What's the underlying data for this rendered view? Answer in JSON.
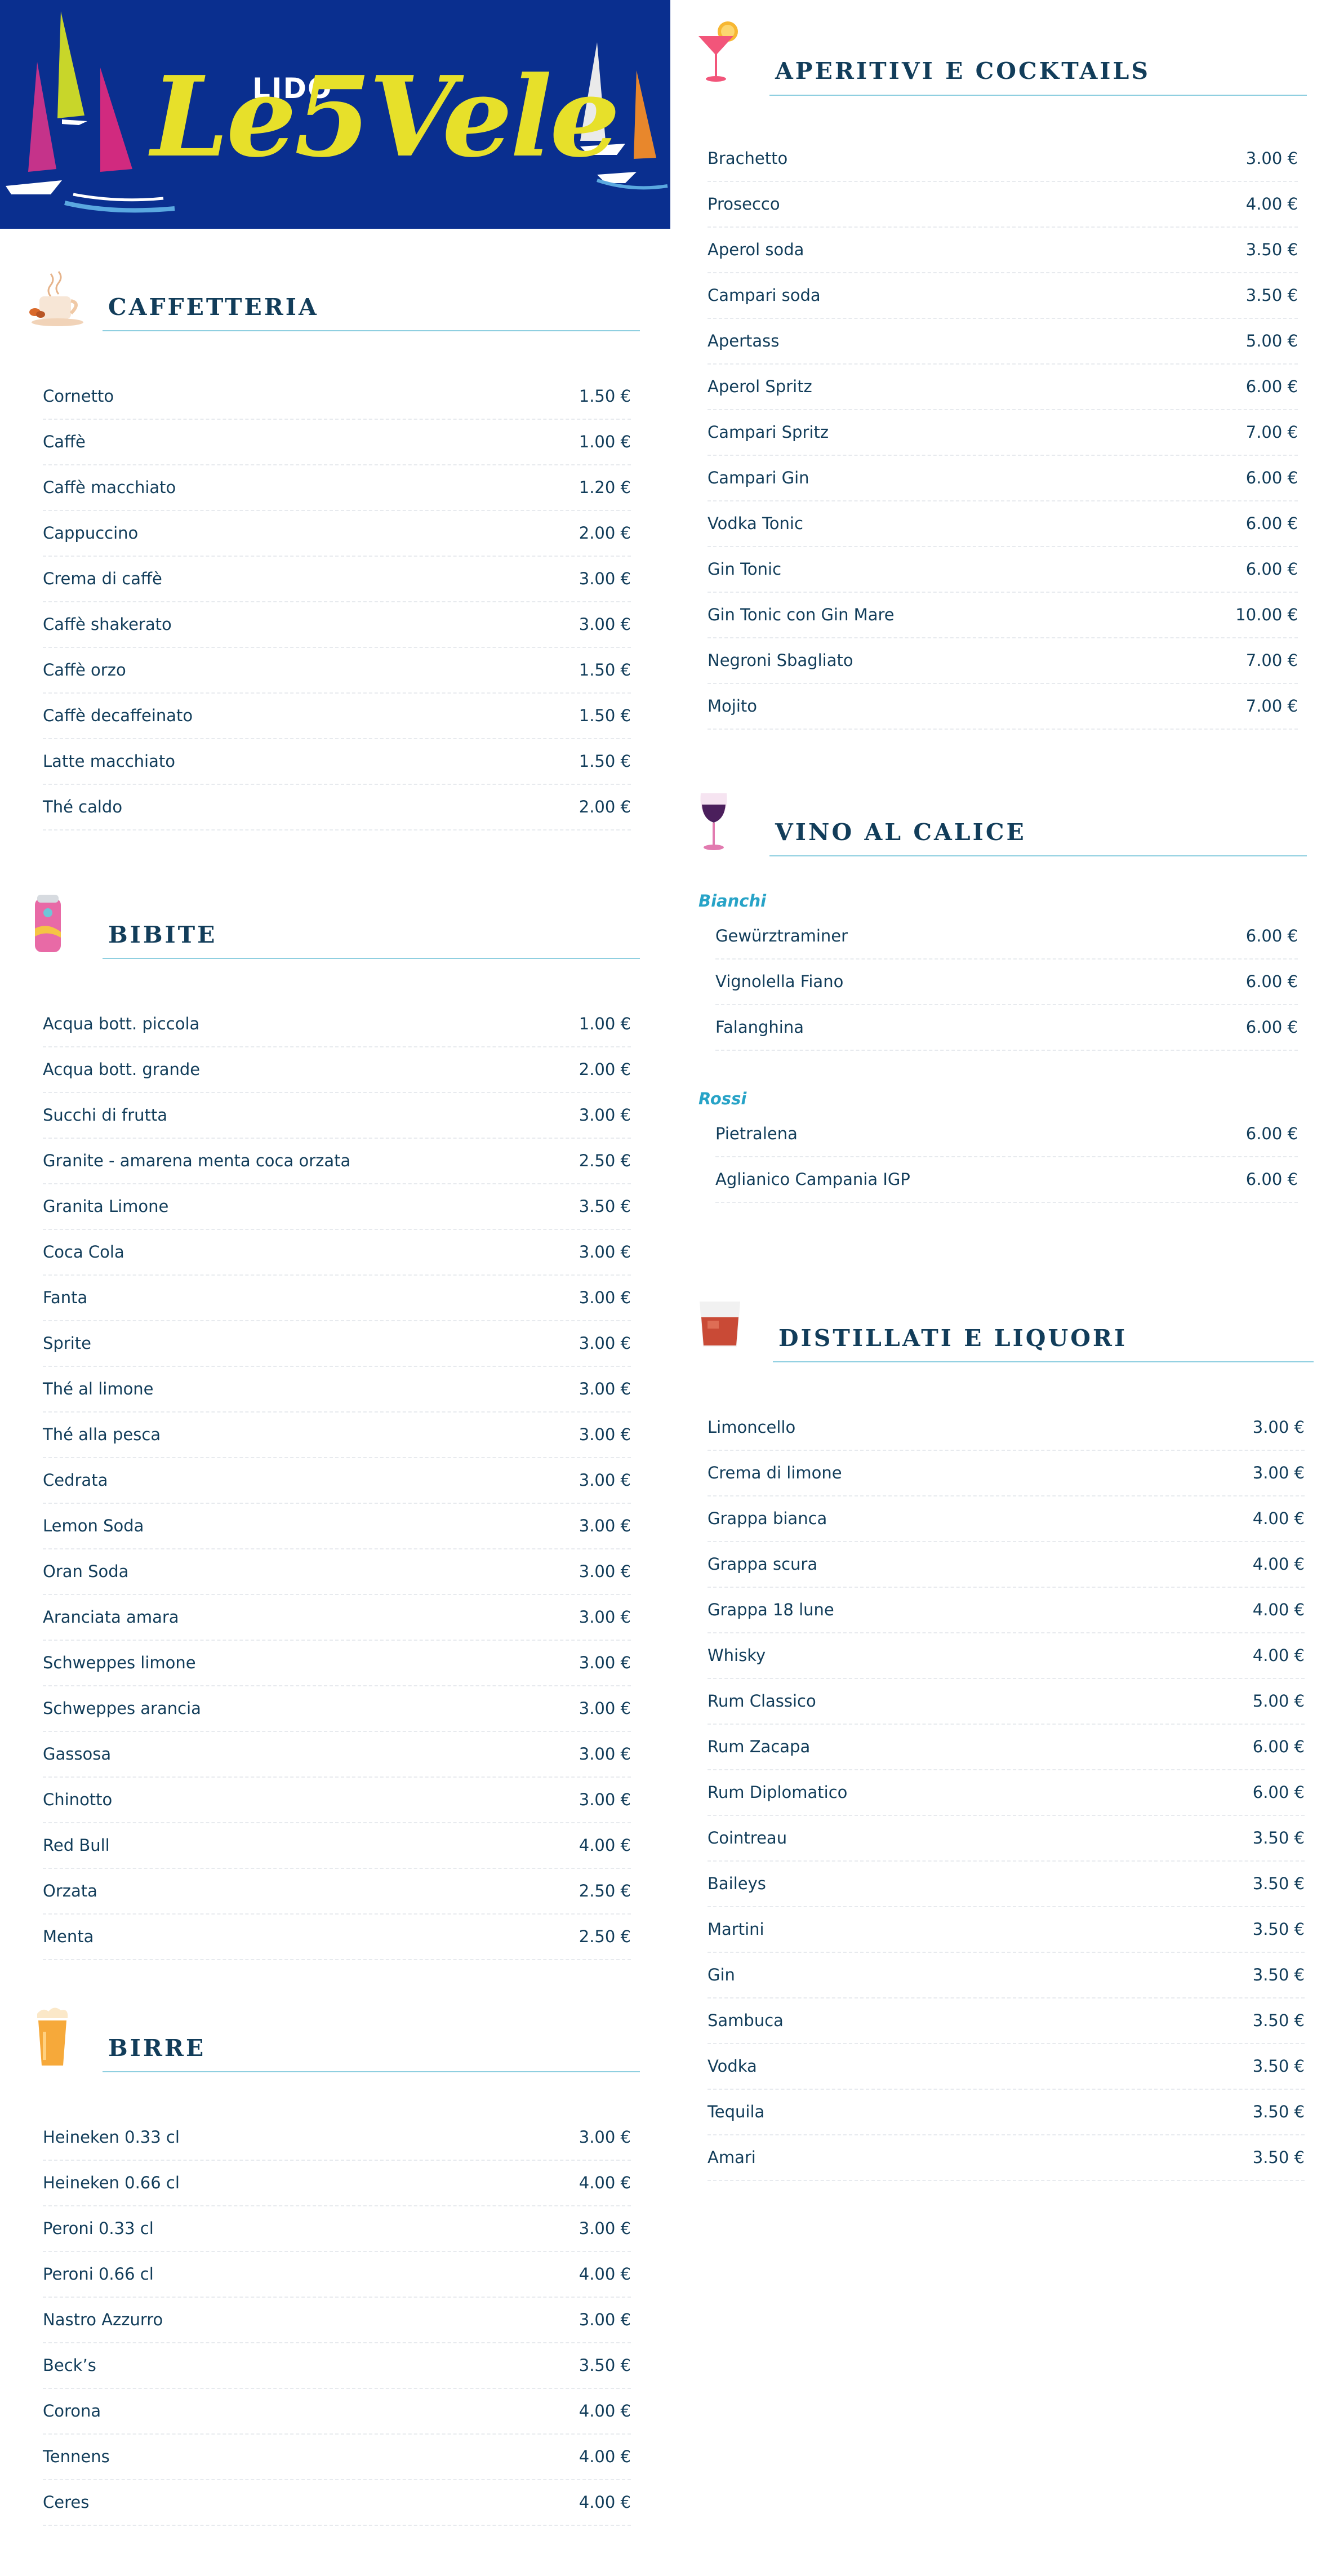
{
  "logo": {
    "top": "LIDO",
    "name": "Le5Vele"
  },
  "sections": {
    "caffetteria": {
      "title": "CAFFETTERIA",
      "icon": "coffee-cup-icon",
      "items": [
        {
          "name": "Cornetto",
          "price": "1.50 €"
        },
        {
          "name": "Caffè",
          "price": "1.00 €"
        },
        {
          "name": "Caffè macchiato",
          "price": "1.20 €"
        },
        {
          "name": "Cappuccino",
          "price": "2.00 €"
        },
        {
          "name": "Crema di caffè",
          "price": "3.00 €"
        },
        {
          "name": "Caffè shakerato",
          "price": "3.00 €"
        },
        {
          "name": "Caffè orzo",
          "price": "1.50 €"
        },
        {
          "name": "Caffè decaffeinato",
          "price": "1.50 €"
        },
        {
          "name": "Latte macchiato",
          "price": "1.50 €"
        },
        {
          "name": "Thé caldo",
          "price": "2.00 €"
        }
      ]
    },
    "bibite": {
      "title": "BIBITE",
      "icon": "soda-can-icon",
      "items": [
        {
          "name": "Acqua bott. piccola",
          "price": "1.00 €"
        },
        {
          "name": "Acqua bott. grande",
          "price": "2.00 €"
        },
        {
          "name": "Succhi di frutta",
          "price": "3.00 €"
        },
        {
          "name": "Granite - amarena menta coca orzata",
          "price": "2.50 €"
        },
        {
          "name": "Granita Limone",
          "price": "3.50 €"
        },
        {
          "name": "Coca Cola",
          "price": "3.00 €"
        },
        {
          "name": "Fanta",
          "price": "3.00 €"
        },
        {
          "name": "Sprite",
          "price": "3.00 €"
        },
        {
          "name": "Thé al limone",
          "price": "3.00 €"
        },
        {
          "name": "Thé alla pesca",
          "price": "3.00 €"
        },
        {
          "name": "Cedrata",
          "price": "3.00 €"
        },
        {
          "name": "Lemon Soda",
          "price": "3.00 €"
        },
        {
          "name": "Oran Soda",
          "price": "3.00 €"
        },
        {
          "name": "Aranciata amara",
          "price": "3.00 €"
        },
        {
          "name": "Schweppes limone",
          "price": "3.00 €"
        },
        {
          "name": "Schweppes arancia",
          "price": "3.00 €"
        },
        {
          "name": "Gassosa",
          "price": "3.00 €"
        },
        {
          "name": "Chinotto",
          "price": "3.00 €"
        },
        {
          "name": "Red Bull",
          "price": "4.00 €"
        },
        {
          "name": "Orzata",
          "price": "2.50 €"
        },
        {
          "name": "Menta",
          "price": "2.50 €"
        }
      ]
    },
    "birre": {
      "title": "BIRRE",
      "icon": "beer-glass-icon",
      "items": [
        {
          "name": "Heineken 0.33 cl",
          "price": "3.00 €"
        },
        {
          "name": "Heineken 0.66 cl",
          "price": "4.00 €"
        },
        {
          "name": "Peroni 0.33 cl",
          "price": "3.00 €"
        },
        {
          "name": "Peroni 0.66 cl",
          "price": "4.00 €"
        },
        {
          "name": "Nastro Azzurro",
          "price": "3.00 €"
        },
        {
          "name": "Beck’s",
          "price": "3.50 €"
        },
        {
          "name": "Corona",
          "price": "4.00 €"
        },
        {
          "name": "Tennens",
          "price": "4.00 €"
        },
        {
          "name": "Ceres",
          "price": "4.00 €"
        }
      ]
    },
    "aperitivi": {
      "title": "APERITIVI E COCKTAILS",
      "icon": "cocktail-glass-icon",
      "items": [
        {
          "name": "Brachetto",
          "price": "3.00 €"
        },
        {
          "name": "Prosecco",
          "price": "4.00 €"
        },
        {
          "name": "Aperol soda",
          "price": "3.50 €"
        },
        {
          "name": "Campari soda",
          "price": "3.50 €"
        },
        {
          "name": "Apertass",
          "price": "5.00 €"
        },
        {
          "name": "Aperol Spritz",
          "price": "6.00 €"
        },
        {
          "name": "Campari Spritz",
          "price": "7.00 €"
        },
        {
          "name": "Campari Gin",
          "price": "6.00 €"
        },
        {
          "name": "Vodka Tonic",
          "price": "6.00 €"
        },
        {
          "name": "Gin Tonic",
          "price": "6.00 €"
        },
        {
          "name": "Gin Tonic con Gin Mare",
          "price": "10.00 €"
        },
        {
          "name": "Negroni Sbagliato",
          "price": "7.00 €"
        },
        {
          "name": "Mojito",
          "price": "7.00 €"
        }
      ]
    },
    "vino": {
      "title": "VINO AL CALICE",
      "icon": "wine-glass-icon",
      "bianchi": {
        "label": "Bianchi",
        "items": [
          {
            "name": "Gewürztraminer",
            "price": "6.00 €"
          },
          {
            "name": "Vignolella Fiano",
            "price": "6.00 €"
          },
          {
            "name": "Falanghina",
            "price": "6.00 €"
          }
        ]
      },
      "rossi": {
        "label": "Rossi",
        "items": [
          {
            "name": "Pietralena",
            "price": "6.00 €"
          },
          {
            "name": "Aglianico Campania IGP",
            "price": "6.00 €"
          }
        ]
      }
    },
    "distillati": {
      "title": "DISTILLATI E LIQUORI",
      "icon": "liquor-glass-icon",
      "items": [
        {
          "name": "Limoncello",
          "price": "3.00 €"
        },
        {
          "name": "Crema di limone",
          "price": "3.00 €"
        },
        {
          "name": "Grappa bianca",
          "price": "4.00 €"
        },
        {
          "name": "Grappa scura",
          "price": "4.00 €"
        },
        {
          "name": "Grappa 18 lune",
          "price": "4.00 €"
        },
        {
          "name": "Whisky",
          "price": "4.00 €"
        },
        {
          "name": "Rum Classico",
          "price": "5.00 €"
        },
        {
          "name": "Rum Zacapa",
          "price": "6.00 €"
        },
        {
          "name": "Rum Diplomatico",
          "price": "6.00 €"
        },
        {
          "name": "Cointreau",
          "price": "3.50 €"
        },
        {
          "name": "Baileys",
          "price": "3.50 €"
        },
        {
          "name": "Martini",
          "price": "3.50 €"
        },
        {
          "name": "Gin",
          "price": "3.50 €"
        },
        {
          "name": "Sambuca",
          "price": "3.50 €"
        },
        {
          "name": "Vodka",
          "price": "3.50 €"
        },
        {
          "name": "Tequila",
          "price": "3.50 €"
        },
        {
          "name": "Amari",
          "price": "3.50 €"
        }
      ]
    }
  }
}
